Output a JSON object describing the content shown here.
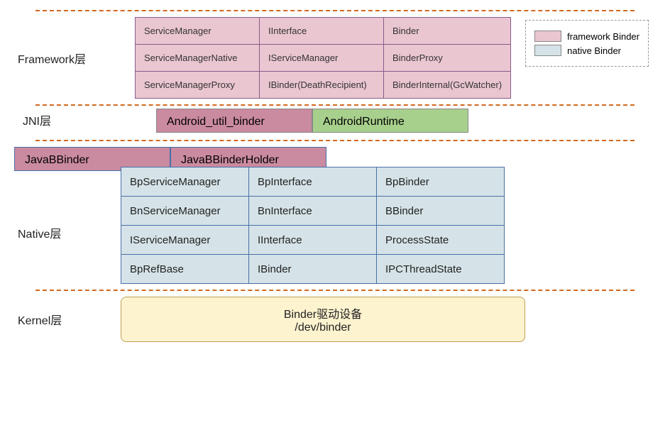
{
  "layers": {
    "framework": {
      "label": "Framework层"
    },
    "jni": {
      "label": "JNI层"
    },
    "native": {
      "label": "Native层"
    },
    "kernel": {
      "label": "Kernel层"
    }
  },
  "frameworkGrid": {
    "r0c0": "ServiceManager",
    "r0c1": "IInterface",
    "r0c2": "Binder",
    "r1c0": "ServiceManagerNative",
    "r1c1": "IServiceManager",
    "r1c2": "BinderProxy",
    "r2c0": "ServiceManagerProxy",
    "r2c1": "IBinder(DeathRecipient)",
    "r2c2": "BinderInternal(GcWatcher)"
  },
  "jniRow": {
    "c0": "Android_util_binder",
    "c1": "AndroidRuntime"
  },
  "jbbRow": {
    "c0": "JavaBBinder",
    "c1": "JavaBBinderHolder"
  },
  "nativeGrid": {
    "r0c0": "BpServiceManager",
    "r0c1": "BpInterface",
    "r0c2": "BpBinder",
    "r1c0": "BnServiceManager",
    "r1c1": "BnInterface",
    "r1c2": "BBinder",
    "r2c0": "IServiceManager",
    "r2c1": "IInterface",
    "r2c2": "ProcessState",
    "r3c0": "BpRefBase",
    "r3c1": "IBinder",
    "r3c2": "IPCThreadState"
  },
  "kernelBox": {
    "line1": "Binder驱动设备",
    "line2": "/dev/binder"
  },
  "legend": {
    "item0": "framework Binder",
    "item1": "native Binder"
  },
  "colors": {
    "pink": "#eac6d1",
    "pinkStrong": "#ca8aa0",
    "green": "#a8d08d",
    "blue": "#d5e3e8",
    "yellow": "#fdf3cf",
    "divider": "#d2691e"
  }
}
